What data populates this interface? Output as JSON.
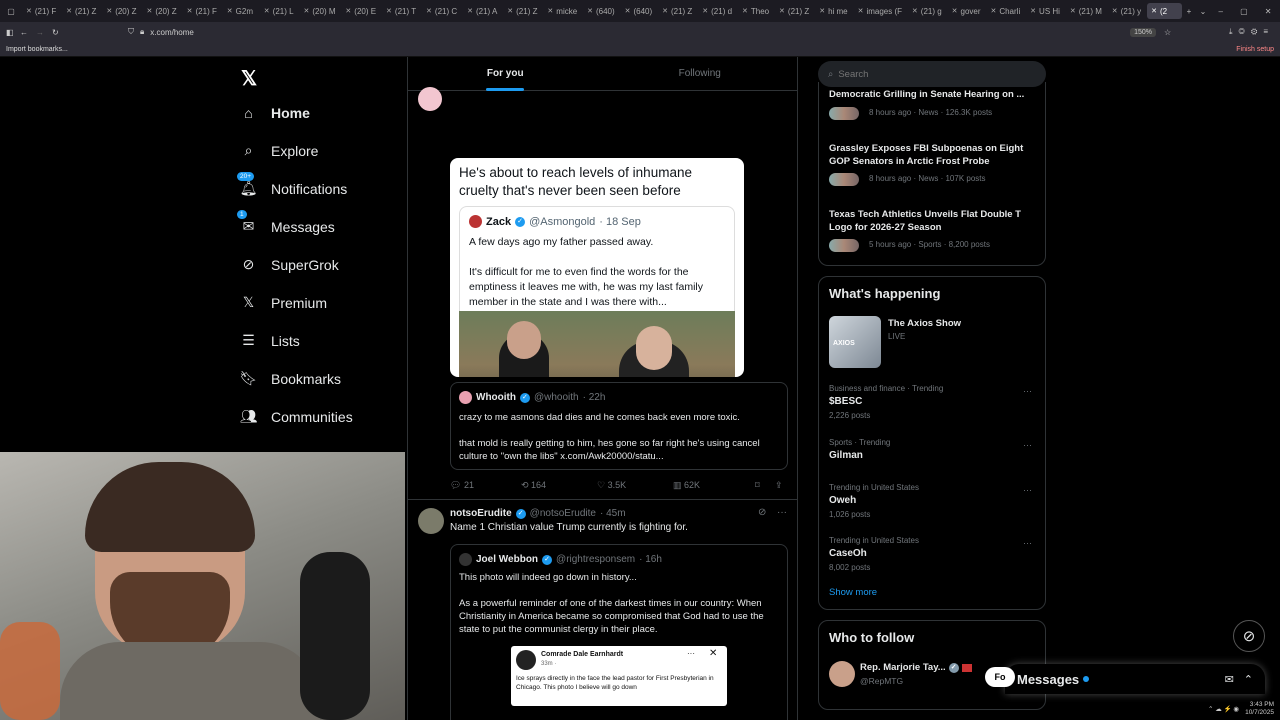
{
  "browser": {
    "tabs": [
      "(21) F",
      "(21) Z",
      "(20) Z",
      "(20) Z",
      "(21) F",
      "G2m",
      "(21) L",
      "(20) M",
      "(20) E",
      "(21) T",
      "(21) C",
      "(21) A",
      "(21) Z",
      "micke",
      "(640)",
      "(640)",
      "(21) Z",
      "(21) d",
      "Theo",
      "(21) Z",
      "hi me",
      "images (F",
      "(21) g",
      "gover",
      "Charli",
      "US Hi",
      "(21) M",
      "(21) y",
      "(2"
    ],
    "url": "x.com/home",
    "zoom": "150%",
    "bookmark": "Import bookmarks...",
    "finish_setup": "Finish setup"
  },
  "sidebar": {
    "items": [
      {
        "label": "Home",
        "icon": "home-icon"
      },
      {
        "label": "Explore",
        "icon": "search-icon"
      },
      {
        "label": "Notifications",
        "icon": "bell-icon",
        "badge": "20+"
      },
      {
        "label": "Messages",
        "icon": "mail-icon",
        "badge": "1"
      },
      {
        "label": "SuperGrok",
        "icon": "grok-icon"
      },
      {
        "label": "Premium",
        "icon": "x-logo-icon"
      },
      {
        "label": "Lists",
        "icon": "list-icon"
      },
      {
        "label": "Bookmarks",
        "icon": "bookmark-icon"
      },
      {
        "label": "Communities",
        "icon": "communities-icon"
      }
    ]
  },
  "tabs": {
    "for_you": "For you",
    "following": "Following"
  },
  "post1": {
    "image_text": "He's about to reach levels of inhumane cruelty that's never been seen before",
    "inner_name": "Zack",
    "inner_handle": "@Asmongold",
    "inner_date": "· 18 Sep",
    "inner_text1": "A few days ago my father passed away.",
    "inner_text2": "It's difficult for me to even find the words for the emptiness it leaves me with, he was my last family member in the state and I was there with...",
    "quote_name": "Whooith",
    "quote_handle": "@whooith",
    "quote_time": "· 22h",
    "quote_text1": "crazy to me asmons dad dies and he comes back even more toxic.",
    "quote_text2": "that mold is really getting to him, hes gone so far right he's using cancel culture to \"own the libs\" x.com/Awk20000/statu...",
    "replies": "21",
    "reposts": "164",
    "likes": "3.5K",
    "views": "62K"
  },
  "post2": {
    "name": "notsoErudite",
    "handle": "@notsoErudite",
    "time": "· 45m",
    "text": "Name 1 Christian value Trump currently is fighting for.",
    "quote_name": "Joel Webbon",
    "quote_handle": "@rightresponsem",
    "quote_time": "· 16h",
    "quote_text1": "This photo will indeed go down in history...",
    "quote_text2": "As a powerful reminder of one of the darkest times in our country: When Christianity in America became so compromised that God had to use the state to put the communist clergy in their place.",
    "fb_name": "Comrade Dale Earnhardt",
    "fb_time": "33m · ",
    "fb_text": "Ice sprays directly in the face the lead pastor for First Presbyterian in Chicago. This photo I believe will go down"
  },
  "search": {
    "placeholder": "Search"
  },
  "news": [
    {
      "title": "Democratic Grilling in Senate Hearing on ...",
      "meta": "8 hours ago · News · 126.3K posts"
    },
    {
      "title": "Grassley Exposes FBI Subpoenas on Eight GOP Senators in Arctic Frost Probe",
      "meta": "8 hours ago · News · 107K posts"
    },
    {
      "title": "Texas Tech Athletics Unveils Flat Double T Logo for 2026-27 Season",
      "meta": "5 hours ago · Sports · 8,200 posts"
    }
  ],
  "happening": {
    "heading": "What's happening",
    "show_title": "The Axios Show",
    "show_status": "LIVE",
    "trends": [
      {
        "context": "Business and finance · Trending",
        "name": "$BESC",
        "posts": "2,226 posts"
      },
      {
        "context": "Sports · Trending",
        "name": "Gilman",
        "posts": ""
      },
      {
        "context": "Trending in United States",
        "name": "Oweh",
        "posts": "1,026 posts"
      },
      {
        "context": "Trending in United States",
        "name": "CaseOh",
        "posts": "8,002 posts"
      }
    ],
    "show_more": "Show more"
  },
  "follow": {
    "heading": "Who to follow",
    "name": "Rep. Marjorie Tay...",
    "handle": "@RepMTG",
    "button": "Fo"
  },
  "messages_drawer": {
    "label": "Messages"
  },
  "taskbar": {
    "time": "3:43 PM",
    "date": "10/7/2025"
  },
  "colors": {
    "accent": "#1d9bf0",
    "border": "#2f3336",
    "muted": "#71767b"
  }
}
